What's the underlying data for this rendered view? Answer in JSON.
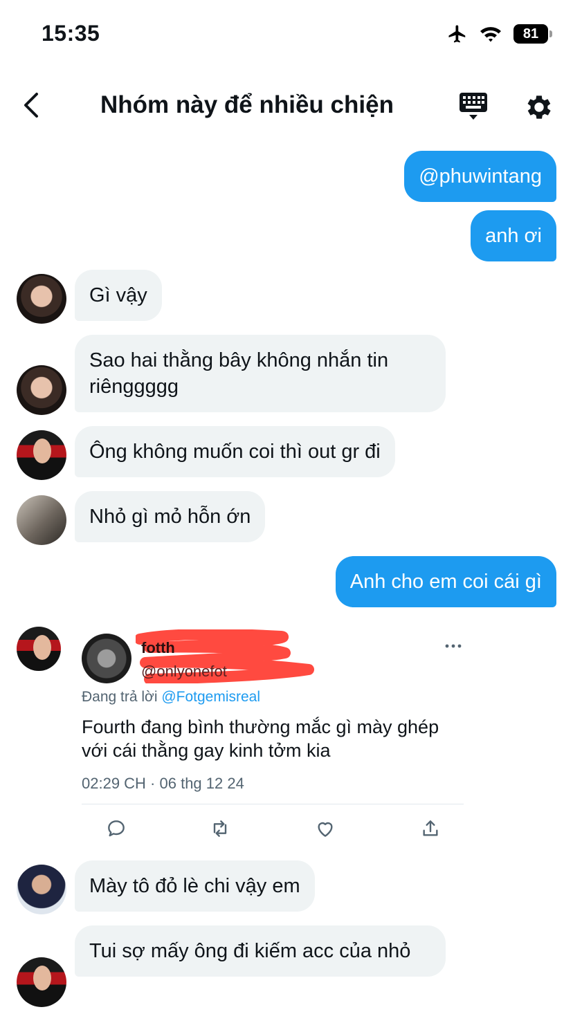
{
  "status_bar": {
    "time": "15:35",
    "battery": "81"
  },
  "header": {
    "title": "Nhóm này để nhiều chiện"
  },
  "messages": {
    "m1": "@phuwintang",
    "m2": "anh ơi",
    "m3": "Gì vậy",
    "m4": "Sao hai thằng bây không nhắn tin riênggggg",
    "m5": "Ông không muốn coi thì out gr đi",
    "m6": "Nhỏ gì mỏ hỗn ớn",
    "m7": "Anh cho em coi cái gì",
    "m8": "Mày tô đỏ lè chi vậy em",
    "m9": "Tui sợ mấy ông đi kiếm acc của nhỏ"
  },
  "tweet": {
    "name": "fotth",
    "handle": "@onlyonefot",
    "reply_prefix": "Đang trả lời ",
    "reply_mention": "@Fotgemisreal",
    "text": "Fourth đang bình thường mắc gì mày ghép với cái thằng gay kinh tởm kia",
    "meta": "02:29 CH · 06 thg 12 24"
  },
  "colors": {
    "accent": "#1d9bf0",
    "bubble_in": "#eff3f4",
    "redaction": "#ff3b30"
  },
  "icons": [
    "airplane-icon",
    "wifi-icon",
    "battery-icon",
    "back-icon",
    "keyboard-icon",
    "gear-icon",
    "more-icon",
    "reply-icon",
    "retweet-icon",
    "like-icon",
    "share-icon"
  ]
}
